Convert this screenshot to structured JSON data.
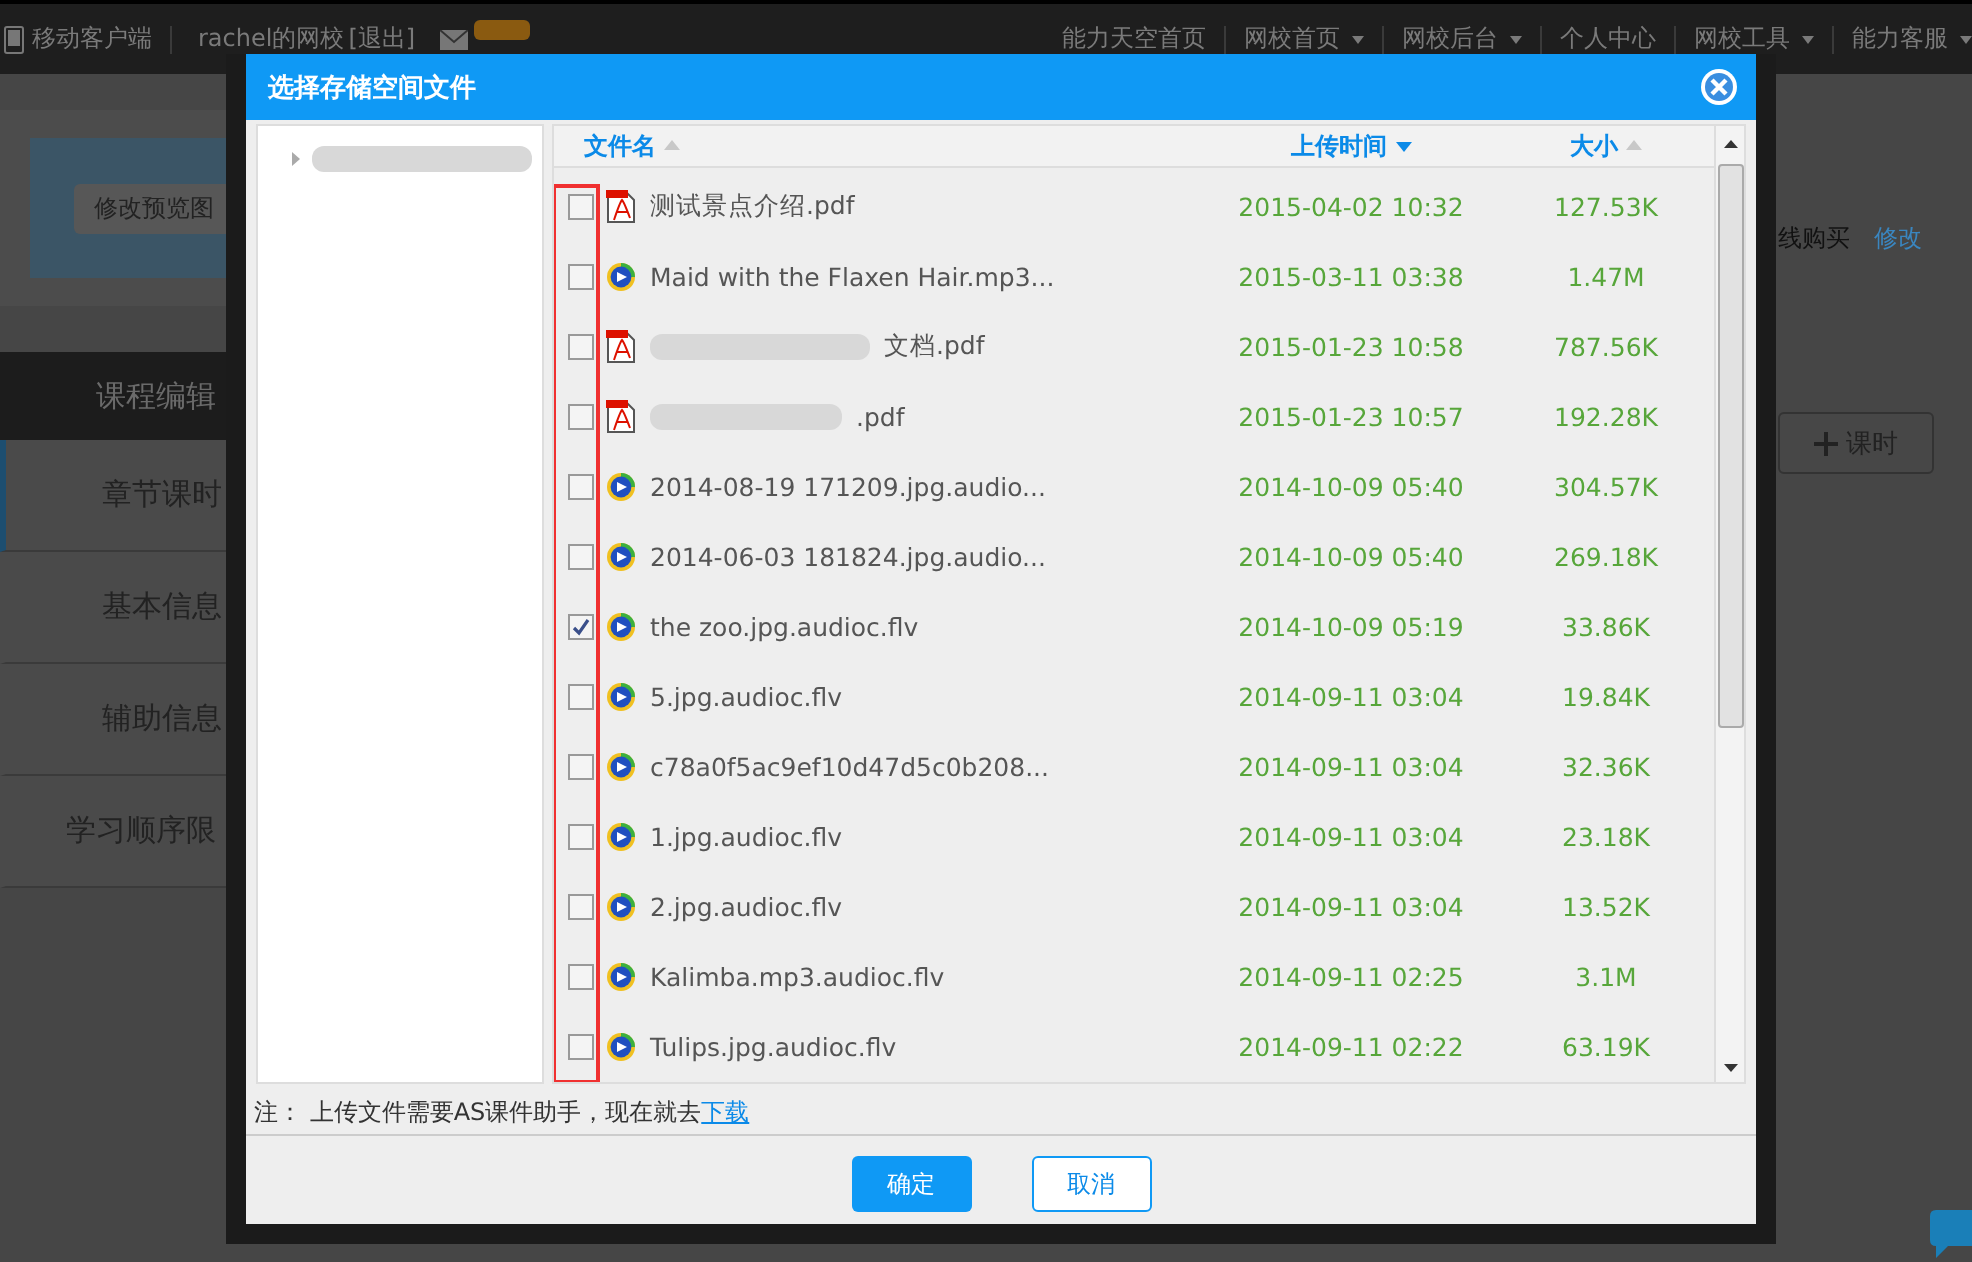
{
  "top_bar": {
    "app_link": "移动客户端",
    "school": "rachel的网校",
    "logout": "[退出]",
    "nav": [
      {
        "label": "能力天空首页",
        "has_menu": false
      },
      {
        "label": "网校首页",
        "has_menu": true
      },
      {
        "label": "网校后台",
        "has_menu": true
      },
      {
        "label": "个人中心",
        "has_menu": false
      },
      {
        "label": "网校工具",
        "has_menu": true
      },
      {
        "label": "能力客服",
        "has_menu": true
      }
    ]
  },
  "preview": {
    "button": "修改预览图"
  },
  "sidebar": {
    "title": "课程编辑",
    "items": [
      {
        "label": "章节课时",
        "selected": true
      },
      {
        "label": "基本信息",
        "selected": false
      },
      {
        "label": "辅助信息",
        "selected": false
      },
      {
        "label": "学习顺序限",
        "selected": false
      }
    ]
  },
  "right_panel": {
    "purchase": "线购买",
    "edit_link": "修改",
    "add_button": "课时"
  },
  "dialog": {
    "title": "选择存储空间文件",
    "columns": [
      {
        "label": "文件名",
        "descending": false,
        "active": false
      },
      {
        "label": "上传时间",
        "descending": true,
        "active": true
      },
      {
        "label": "大小",
        "descending": false,
        "active": false
      }
    ],
    "files": [
      {
        "kind": "pdf",
        "name": "测试景点介绍.pdf",
        "blurred": false,
        "time": "2015-04-02 10:32",
        "size": "127.53K",
        "checked": false
      },
      {
        "kind": "media",
        "name": "Maid with the Flaxen Hair.mp3...",
        "blurred": false,
        "time": "2015-03-11 03:38",
        "size": "1.47M",
        "checked": false
      },
      {
        "kind": "pdf",
        "name": "文档.pdf",
        "blurred": true,
        "time": "2015-01-23 10:58",
        "size": "787.56K",
        "checked": false
      },
      {
        "kind": "pdf",
        "name": ".pdf",
        "blurred": true,
        "time": "2015-01-23 10:57",
        "size": "192.28K",
        "checked": false
      },
      {
        "kind": "media",
        "name": "2014-08-19 171209.jpg.audio...",
        "blurred": false,
        "time": "2014-10-09 05:40",
        "size": "304.57K",
        "checked": false
      },
      {
        "kind": "media",
        "name": "2014-06-03 181824.jpg.audio...",
        "blurred": false,
        "time": "2014-10-09 05:40",
        "size": "269.18K",
        "checked": false
      },
      {
        "kind": "media",
        "name": "the zoo.jpg.audioc.flv",
        "blurred": false,
        "time": "2014-10-09 05:19",
        "size": "33.86K",
        "checked": true
      },
      {
        "kind": "media",
        "name": "5.jpg.audioc.flv",
        "blurred": false,
        "time": "2014-09-11 03:04",
        "size": "19.84K",
        "checked": false
      },
      {
        "kind": "media",
        "name": "c78a0f5ac9ef10d47d5c0b208...",
        "blurred": false,
        "time": "2014-09-11 03:04",
        "size": "32.36K",
        "checked": false
      },
      {
        "kind": "media",
        "name": "1.jpg.audioc.flv",
        "blurred": false,
        "time": "2014-09-11 03:04",
        "size": "23.18K",
        "checked": false
      },
      {
        "kind": "media",
        "name": "2.jpg.audioc.flv",
        "blurred": false,
        "time": "2014-09-11 03:04",
        "size": "13.52K",
        "checked": false
      },
      {
        "kind": "media",
        "name": "Kalimba.mp3.audioc.flv",
        "blurred": false,
        "time": "2014-09-11 02:25",
        "size": "3.1M",
        "checked": false
      },
      {
        "kind": "media",
        "name": "Tulips.jpg.audioc.flv",
        "blurred": false,
        "time": "2014-09-11 02:22",
        "size": "63.19K",
        "checked": false
      }
    ],
    "note": "注： 上传文件需要AS课件助手，现在就去",
    "note_link": "下载",
    "buttons": [
      {
        "label": "确定",
        "kind": "primary"
      },
      {
        "label": "取消",
        "kind": "secondary"
      }
    ]
  }
}
